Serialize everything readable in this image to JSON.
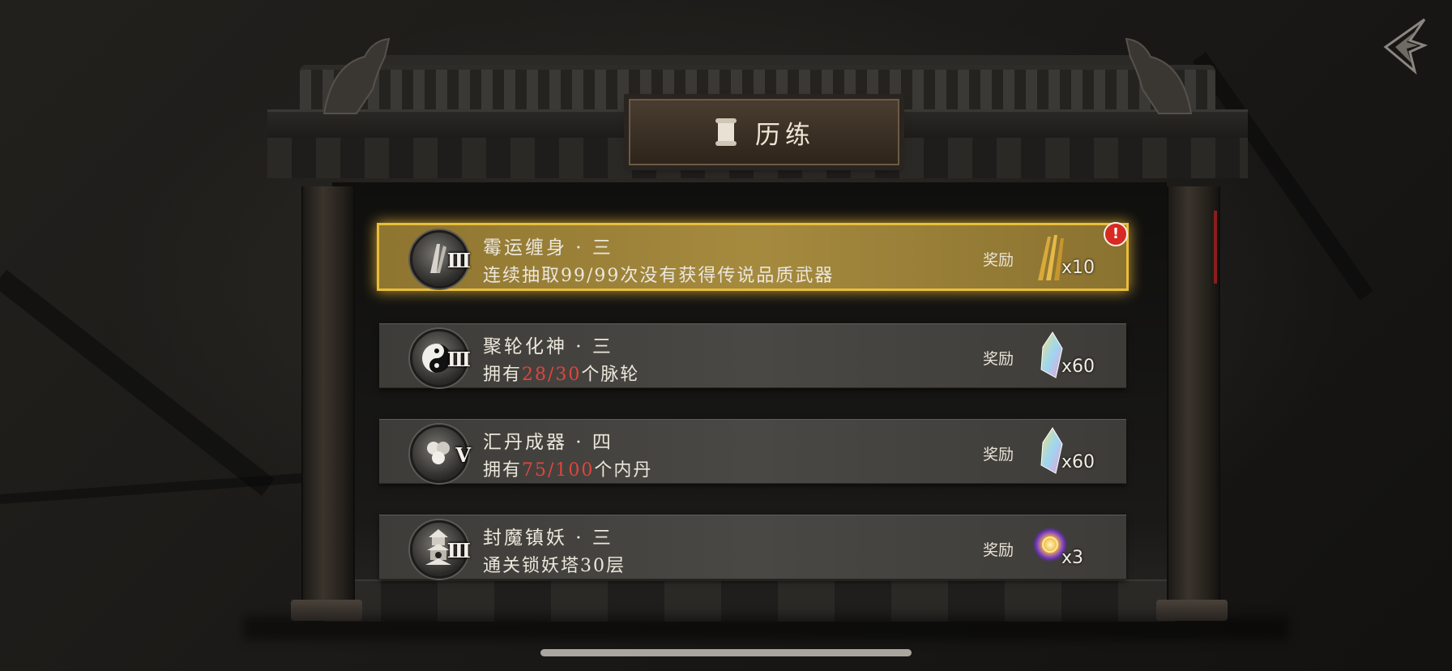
{
  "header": {
    "title": "历练"
  },
  "quests": [
    {
      "title": "霉运缠身 · 三",
      "tier": "Ⅲ",
      "desc_prefix": "连续抽取99/99次没有获得传说品质武器",
      "desc_highlight": "",
      "desc_suffix": "",
      "reward_label": "奖励",
      "reward_icon": "arrows-icon",
      "reward_count": "x10",
      "completed": true,
      "badge": "!"
    },
    {
      "title": "聚轮化神 · 三",
      "tier": "Ⅲ",
      "desc_prefix": "拥有",
      "desc_highlight": "28/30",
      "desc_suffix": "个脉轮",
      "reward_label": "奖励",
      "reward_icon": "crystal-icon",
      "reward_count": "x60",
      "completed": false
    },
    {
      "title": "汇丹成器 · 四",
      "tier": "Ⅴ",
      "desc_prefix": "拥有",
      "desc_highlight": "75/100",
      "desc_suffix": "个内丹",
      "reward_label": "奖励",
      "reward_icon": "crystal-icon",
      "reward_count": "x60",
      "completed": false
    },
    {
      "title": "封魔镇妖 · 三",
      "tier": "Ⅲ",
      "desc_prefix": "通关锁妖塔30层",
      "desc_highlight": "",
      "desc_suffix": "",
      "reward_label": "奖励",
      "reward_icon": "orb-icon",
      "reward_count": "x3",
      "completed": false
    }
  ],
  "colors": {
    "highlight": "#e2443c",
    "active_glow": "#e9bd3c",
    "alert": "#d62a22"
  }
}
